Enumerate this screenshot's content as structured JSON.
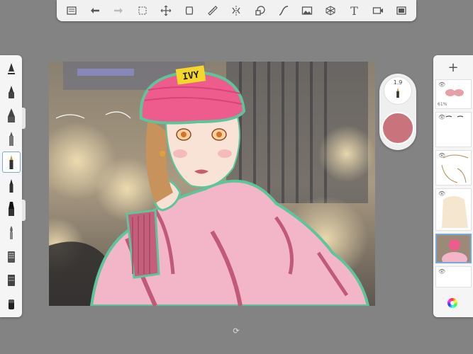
{
  "app": {
    "accent": "#7aa8d8"
  },
  "toolbar": {
    "items": [
      {
        "icon": "gallery-icon"
      },
      {
        "icon": "undo-icon"
      },
      {
        "icon": "redo-icon"
      },
      {
        "icon": "selection-icon"
      },
      {
        "icon": "transform-icon"
      },
      {
        "icon": "layer-select-icon"
      },
      {
        "icon": "ruler-icon"
      },
      {
        "icon": "symmetry-icon"
      },
      {
        "icon": "shapes-icon"
      },
      {
        "icon": "curve-icon"
      },
      {
        "icon": "image-icon"
      },
      {
        "icon": "perspective-icon"
      },
      {
        "icon": "text-icon"
      },
      {
        "icon": "record-icon"
      },
      {
        "icon": "fullscreen-icon"
      }
    ],
    "text_glyph": "T"
  },
  "brushes": {
    "items": [
      "pencil",
      "pen",
      "marker",
      "airbrush",
      "ink-pen",
      "brush",
      "chisel",
      "paint-brush",
      "smudge",
      "blur",
      "eraser"
    ],
    "selected_index": 4
  },
  "puck": {
    "size_label": "1.9",
    "color": "#c9737d"
  },
  "canvas": {
    "hat_text": "IVY"
  },
  "layers": {
    "add_label": "+",
    "items": [
      {
        "opacity_label": "61%"
      },
      {
        "opacity_label": ""
      },
      {
        "opacity_label": ""
      },
      {
        "opacity_label": ""
      },
      {
        "opacity_label": ""
      },
      {
        "opacity_label": ""
      }
    ]
  }
}
